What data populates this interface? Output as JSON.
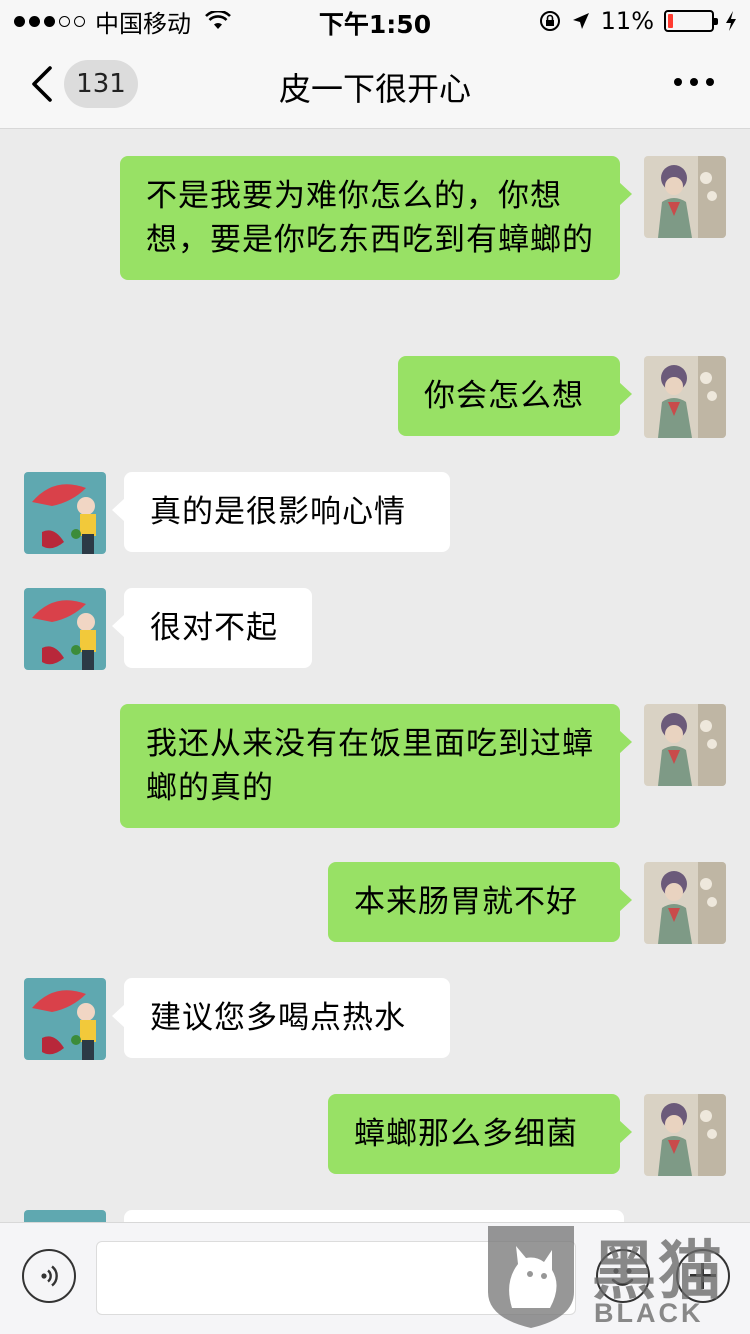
{
  "status_bar": {
    "carrier": "中国移动",
    "time": "下午1:50",
    "battery_percent_text": "11%",
    "battery_level": 0.11,
    "battery_color": "#ff3b30",
    "signal_bars_filled": 3,
    "signal_bars_total": 5
  },
  "nav": {
    "unread_count": "131",
    "title": "皮一下很开心",
    "back_icon": "chevron-left-icon",
    "more_icon": "more-dots-icon"
  },
  "messages": [
    {
      "side": "out",
      "text": "不是我要为难你怎么的，你想想，要是你吃东西吃到有蟑螂的"
    },
    {
      "side": "out",
      "text": "你会怎么想"
    },
    {
      "side": "in",
      "text": "真的是很影响心情"
    },
    {
      "side": "in",
      "text": "很对不起"
    },
    {
      "side": "out",
      "text": "我还从来没有在饭里面吃到过蟑螂的真的"
    },
    {
      "side": "out",
      "text": "本来肠胃就不好"
    },
    {
      "side": "in",
      "text": "建议您多喝点热水"
    },
    {
      "side": "out",
      "text": "蟑螂那么多细菌"
    },
    {
      "side": "in",
      "text": ""
    }
  ],
  "input_bar": {
    "voice_icon": "voice-icon",
    "emoji_icon": "emoji-icon",
    "plus_icon": "plus-icon",
    "input_value": ""
  },
  "watermark": {
    "cjk": "黑猫",
    "latin": "BLACK CAT"
  },
  "colors": {
    "outgoing_bubble": "#98e165",
    "incoming_bubble": "#ffffff",
    "background": "#ebebeb"
  }
}
